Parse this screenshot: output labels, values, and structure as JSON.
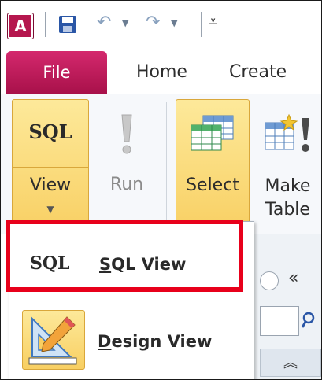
{
  "app": {
    "icon_letter": "A"
  },
  "quick_access": {
    "save_icon": "save-icon",
    "undo_icon": "undo-icon",
    "redo_icon": "redo-icon",
    "customize_icon": "customize-qat-icon"
  },
  "tabs": [
    {
      "label": "File",
      "active": true
    },
    {
      "label": "Home"
    },
    {
      "label": "Create"
    }
  ],
  "ribbon": {
    "view": {
      "glyph": "SQL",
      "label": "View"
    },
    "run": {
      "label": "Run"
    },
    "select": {
      "label": "Select"
    },
    "make_table": {
      "label_line1": "Make",
      "label_line2": "Table"
    }
  },
  "view_menu": {
    "items": [
      {
        "glyph": "SQL",
        "label_accel": "S",
        "label_rest": "QL View"
      },
      {
        "label_accel": "D",
        "label_rest": "esign View"
      }
    ]
  },
  "nav_pane": {
    "collapse_glyph": "«",
    "expand_glyph": "︽"
  },
  "colors": {
    "file_tab": "#c0195a",
    "highlight_box": "#e8001b",
    "button_active": "#f8cf62"
  }
}
